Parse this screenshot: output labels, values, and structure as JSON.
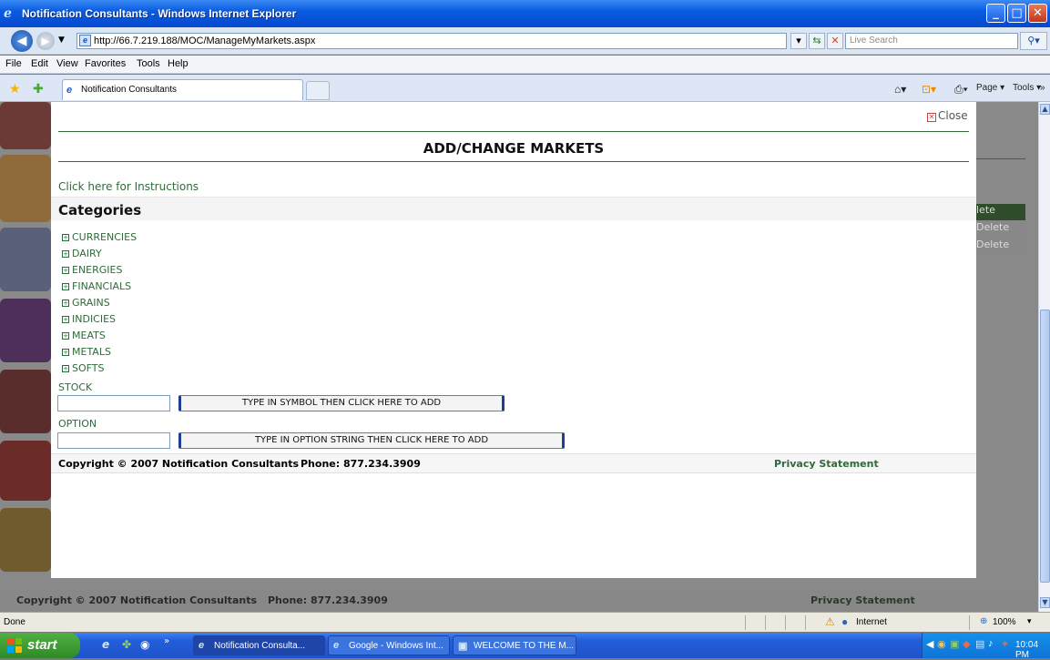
{
  "window": {
    "title": "Notification Consultants - Windows Internet Explorer"
  },
  "addressbar": {
    "url": "http://66.7.219.188/MOC/ManageMyMarkets.aspx",
    "search_placeholder": "Live Search"
  },
  "menu": [
    "File",
    "Edit",
    "View",
    "Favorites",
    "Tools",
    "Help"
  ],
  "tabs": {
    "active": "Notification Consultants"
  },
  "commandbar": {
    "page_label": "Page ▾",
    "tools_label": "Tools ▾"
  },
  "modal": {
    "close_label": "Close",
    "title": "ADD/CHANGE MARKETS",
    "instructions_link": "Click here for Instructions",
    "categories_title": "Categories",
    "categories": [
      "CURRENCIES",
      "DAIRY",
      "ENERGIES",
      "FINANCIALS",
      "GRAINS",
      "INDICIES",
      "MEATS",
      "METALS",
      "SOFTS"
    ],
    "stock_label": "STOCK",
    "stock_button": "TYPE IN SYMBOL THEN CLICK HERE TO ADD",
    "option_label": "OPTION",
    "option_button": "TYPE IN OPTION STRING THEN CLICK HERE TO ADD",
    "footer": {
      "copyright": "Copyright © 2007 Notification Consultants",
      "phone": "Phone: 877.234.3909",
      "privacy": "Privacy Statement"
    }
  },
  "background": {
    "delete_labels": [
      "lete",
      "Delete",
      "Delete"
    ],
    "footer": {
      "copyright": "Copyright © 2007 Notification Consultants",
      "phone": "Phone: 877.234.3909",
      "privacy": "Privacy Statement"
    }
  },
  "statusbar": {
    "status": "Done",
    "zone": "Internet",
    "zoom": "100%"
  },
  "taskbar": {
    "start_label": "start",
    "items": [
      "Notification Consulta...",
      "Google - Windows Int...",
      "WELCOME TO THE M..."
    ],
    "clock": "10:04 PM"
  }
}
